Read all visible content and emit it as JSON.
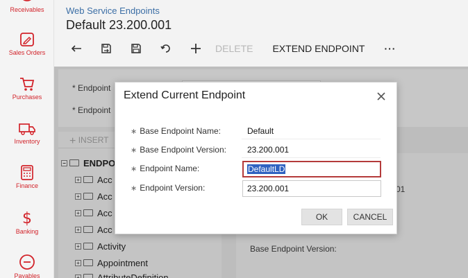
{
  "nav": {
    "items": [
      {
        "label": "Receivables",
        "icon": "receivables-icon"
      },
      {
        "label": "Sales Orders",
        "icon": "sales-orders-icon"
      },
      {
        "label": "Purchases",
        "icon": "cart-icon"
      },
      {
        "label": "Inventory",
        "icon": "truck-icon"
      },
      {
        "label": "Finance",
        "icon": "calculator-icon"
      },
      {
        "label": "Banking",
        "icon": "dollar-icon"
      },
      {
        "label": "Payables",
        "icon": "minus-circle-icon"
      }
    ]
  },
  "header": {
    "breadcrumb": "Web Service Endpoints",
    "title": "Default 23.200.001"
  },
  "toolbar": {
    "delete_label": "DELETE",
    "extend_label": "EXTEND ENDPOINT",
    "more_label": "···"
  },
  "background": {
    "endpoint_label_1": "* Endpoint",
    "endpoint_label_2": "* Endpoint",
    "insert_label": "INSERT",
    "tree_root": "ENDPOINT",
    "tree_items": [
      "Acc",
      "Acc",
      "Acc",
      "Acc",
      "Activity",
      "Appointment",
      "AttributeDefinition"
    ],
    "right_value": "01",
    "base_endpoint_version_label": "Base Endpoint Version:"
  },
  "modal": {
    "title": "Extend Current Endpoint",
    "fields": [
      {
        "label": "Base Endpoint Name:",
        "value": "Default"
      },
      {
        "label": "Base Endpoint Version:",
        "value": "23.200.001"
      },
      {
        "label": "Endpoint Name:",
        "value": "DefaultLD"
      },
      {
        "label": "Endpoint Version:",
        "value": "23.200.001"
      }
    ],
    "required_mark": "∗",
    "ok_label": "OK",
    "cancel_label": "CANCEL"
  },
  "colors": {
    "accent": "#d2232a",
    "link": "#3b6ea5",
    "selection": "#2f62c1"
  }
}
